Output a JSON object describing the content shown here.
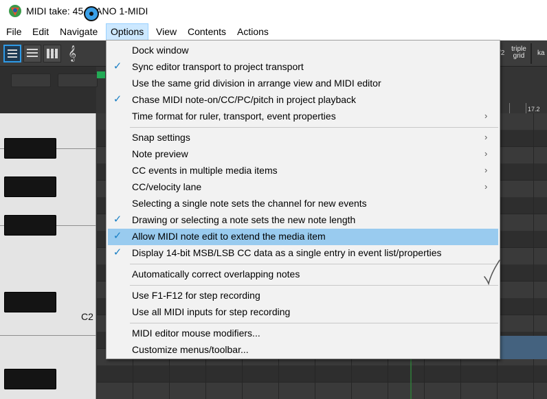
{
  "window": {
    "title": "MIDI take: 45-PIANO 1-MIDI"
  },
  "menubar": {
    "items": [
      {
        "label": "File"
      },
      {
        "label": "Edit"
      },
      {
        "label": "Navigate"
      },
      {
        "label": "Options",
        "active": true
      },
      {
        "label": "View"
      },
      {
        "label": "Contents"
      },
      {
        "label": "Actions"
      }
    ]
  },
  "toolbar": {
    "buttons": [
      "piano-roll-view-icon",
      "named-notes-view-icon",
      "drum-grid-view-icon",
      "treble-clef-icon",
      "midi-input-icon"
    ],
    "right_number": "/2",
    "grid_label": "triple grid",
    "right_cut": "ka"
  },
  "ruler": {
    "tick_label": "17.2"
  },
  "piano": {
    "note_label": "C2"
  },
  "options_menu": {
    "items": [
      {
        "label": "Dock window",
        "checked": false,
        "submenu": false
      },
      {
        "label": "Sync editor transport to project transport",
        "checked": true,
        "submenu": false
      },
      {
        "label": "Use the same grid division in arrange view and MIDI editor",
        "checked": false,
        "submenu": false
      },
      {
        "label": "Chase MIDI note-on/CC/PC/pitch in project playback",
        "checked": true,
        "submenu": false
      },
      {
        "label": "Time format for ruler, transport, event properties",
        "checked": false,
        "submenu": true
      },
      {
        "separator": true
      },
      {
        "label": "Snap settings",
        "checked": false,
        "submenu": true
      },
      {
        "label": "Note preview",
        "checked": false,
        "submenu": true
      },
      {
        "label": "CC events in multiple media items",
        "checked": false,
        "submenu": true
      },
      {
        "label": "CC/velocity lane",
        "checked": false,
        "submenu": true
      },
      {
        "label": "Selecting a single note sets the channel for new events",
        "checked": false,
        "submenu": false
      },
      {
        "label": "Drawing or selecting a note sets the new note length",
        "checked": true,
        "submenu": false
      },
      {
        "label": "Allow MIDI note edit to extend the media item",
        "checked": true,
        "submenu": false,
        "highlighted": true
      },
      {
        "label": "Display 14-bit MSB/LSB CC data as a single entry in event list/properties",
        "checked": true,
        "submenu": false
      },
      {
        "separator": true
      },
      {
        "label": "Automatically correct overlapping notes",
        "checked": false,
        "submenu": false
      },
      {
        "separator": true
      },
      {
        "label": "Use F1-F12 for step recording",
        "checked": false,
        "submenu": false
      },
      {
        "label": "Use all MIDI inputs for step recording",
        "checked": false,
        "submenu": false
      },
      {
        "separator": true
      },
      {
        "label": "MIDI editor mouse modifiers...",
        "checked": false,
        "submenu": false
      },
      {
        "label": "Customize menus/toolbar...",
        "checked": false,
        "submenu": false
      }
    ],
    "check_glyph": "✓",
    "arrow_glyph": "›"
  },
  "colors": {
    "menu_highlight": "#99cbef",
    "active_menu_bg": "#cce8ff",
    "check_color": "#1a7fc4",
    "toolbar_accent": "#2f9be8"
  }
}
